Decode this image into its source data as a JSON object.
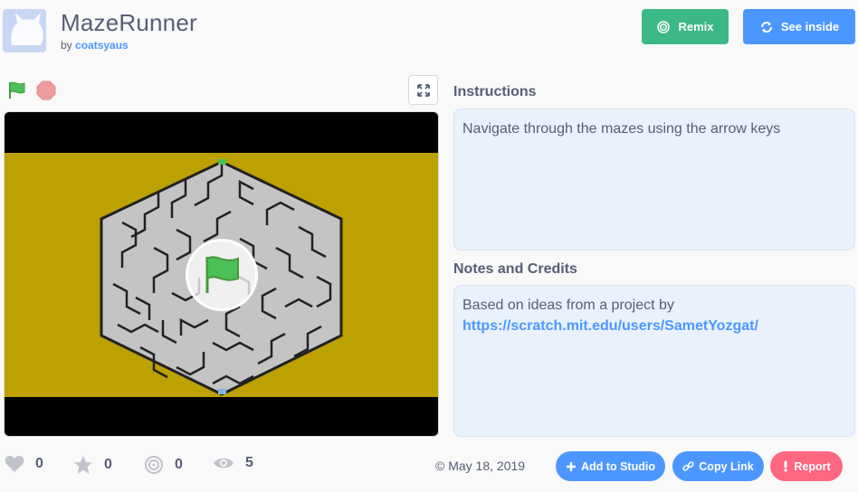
{
  "project": {
    "title": "MazeRunner",
    "by_label": "by",
    "author": "coatsyaus"
  },
  "header": {
    "remix_label": "Remix",
    "see_inside_label": "See inside"
  },
  "player": {
    "flag_icon": "green-flag-icon",
    "stop_icon": "stop-icon",
    "fullscreen_icon": "fullscreen-icon"
  },
  "instructions": {
    "heading": "Instructions",
    "text": "Navigate through the mazes using the arrow keys"
  },
  "notes": {
    "heading": "Notes and Credits",
    "text": "Based on ideas from a project by",
    "link": "https://scratch.mit.edu/users/SametYozgat/"
  },
  "stats": {
    "loves": "0",
    "favorites": "0",
    "remixes": "0",
    "views": "5"
  },
  "footer": {
    "date": "May 18, 2019",
    "add_to_studio_label": "Add to Studio",
    "copy_link_label": "Copy Link",
    "report_label": "Report"
  },
  "colors": {
    "remix": "#3cb887",
    "blue": "#4c97ff",
    "report": "#ff6680",
    "stage_field": "#bca100"
  }
}
